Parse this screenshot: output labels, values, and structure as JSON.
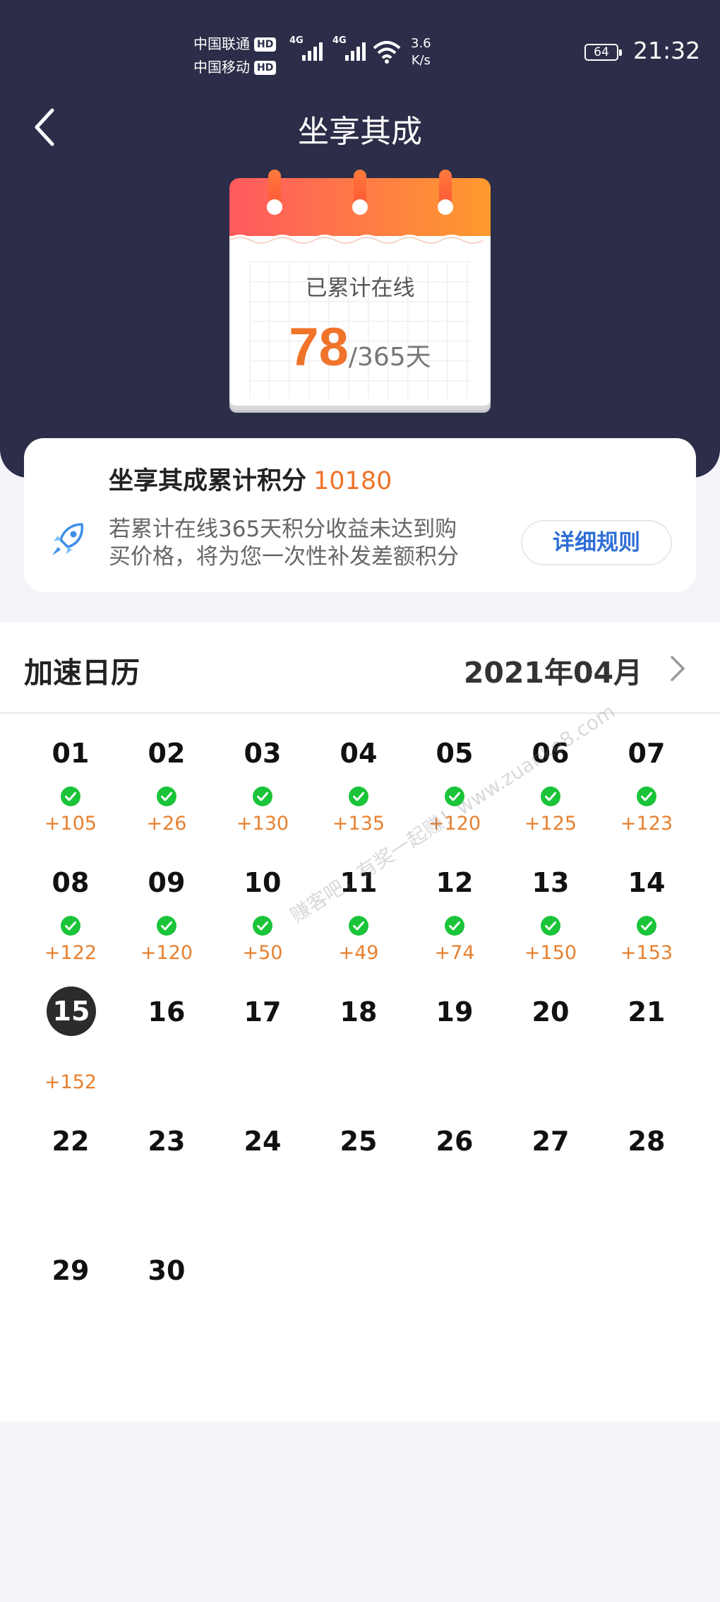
{
  "status_bar": {
    "carriers": [
      {
        "name": "中国联通",
        "hd": "HD"
      },
      {
        "name": "中国移动",
        "hd": "HD"
      }
    ],
    "network": [
      "4G",
      "4G"
    ],
    "speed_value": "3.6",
    "speed_unit": "K/s",
    "battery": "64",
    "time": "21:32"
  },
  "header": {
    "title": "坐享其成",
    "back_icon": "chevron-left-icon",
    "online_label": "已累计在线",
    "online_days": "78",
    "online_total": "/365天"
  },
  "points": {
    "label": "坐享其成累计积分",
    "value": "10180",
    "description": "若累计在线365天积分收益未达到购买价格，将为您一次性补发差额积分",
    "rules_button": "详细规则",
    "icon": "rocket-icon"
  },
  "calendar": {
    "title": "加速日历",
    "month": "2021年04月",
    "today": "15",
    "days": [
      {
        "day": "01",
        "checked": true,
        "points": "+105"
      },
      {
        "day": "02",
        "checked": true,
        "points": "+26"
      },
      {
        "day": "03",
        "checked": true,
        "points": "+130"
      },
      {
        "day": "04",
        "checked": true,
        "points": "+135"
      },
      {
        "day": "05",
        "checked": true,
        "points": "+120"
      },
      {
        "day": "06",
        "checked": true,
        "points": "+125"
      },
      {
        "day": "07",
        "checked": true,
        "points": "+123"
      },
      {
        "day": "08",
        "checked": true,
        "points": "+122"
      },
      {
        "day": "09",
        "checked": true,
        "points": "+120"
      },
      {
        "day": "10",
        "checked": true,
        "points": "+50"
      },
      {
        "day": "11",
        "checked": true,
        "points": "+49"
      },
      {
        "day": "12",
        "checked": true,
        "points": "+74"
      },
      {
        "day": "13",
        "checked": true,
        "points": "+150"
      },
      {
        "day": "14",
        "checked": true,
        "points": "+153"
      },
      {
        "day": "15",
        "checked": false,
        "points": "+152"
      },
      {
        "day": "16",
        "checked": false,
        "points": ""
      },
      {
        "day": "17",
        "checked": false,
        "points": ""
      },
      {
        "day": "18",
        "checked": false,
        "points": ""
      },
      {
        "day": "19",
        "checked": false,
        "points": ""
      },
      {
        "day": "20",
        "checked": false,
        "points": ""
      },
      {
        "day": "21",
        "checked": false,
        "points": ""
      },
      {
        "day": "22",
        "checked": false,
        "points": ""
      },
      {
        "day": "23",
        "checked": false,
        "points": ""
      },
      {
        "day": "24",
        "checked": false,
        "points": ""
      },
      {
        "day": "25",
        "checked": false,
        "points": ""
      },
      {
        "day": "26",
        "checked": false,
        "points": ""
      },
      {
        "day": "27",
        "checked": false,
        "points": ""
      },
      {
        "day": "28",
        "checked": false,
        "points": ""
      },
      {
        "day": "29",
        "checked": false,
        "points": ""
      },
      {
        "day": "30",
        "checked": false,
        "points": ""
      }
    ]
  },
  "watermark": "赚客吧，有奖一起赚！www.zuanke8.com",
  "colors": {
    "header_bg": "#2c2d48",
    "accent_orange": "#f0732a",
    "check_green": "#1cc43a",
    "link_blue": "#2f6fd6"
  }
}
